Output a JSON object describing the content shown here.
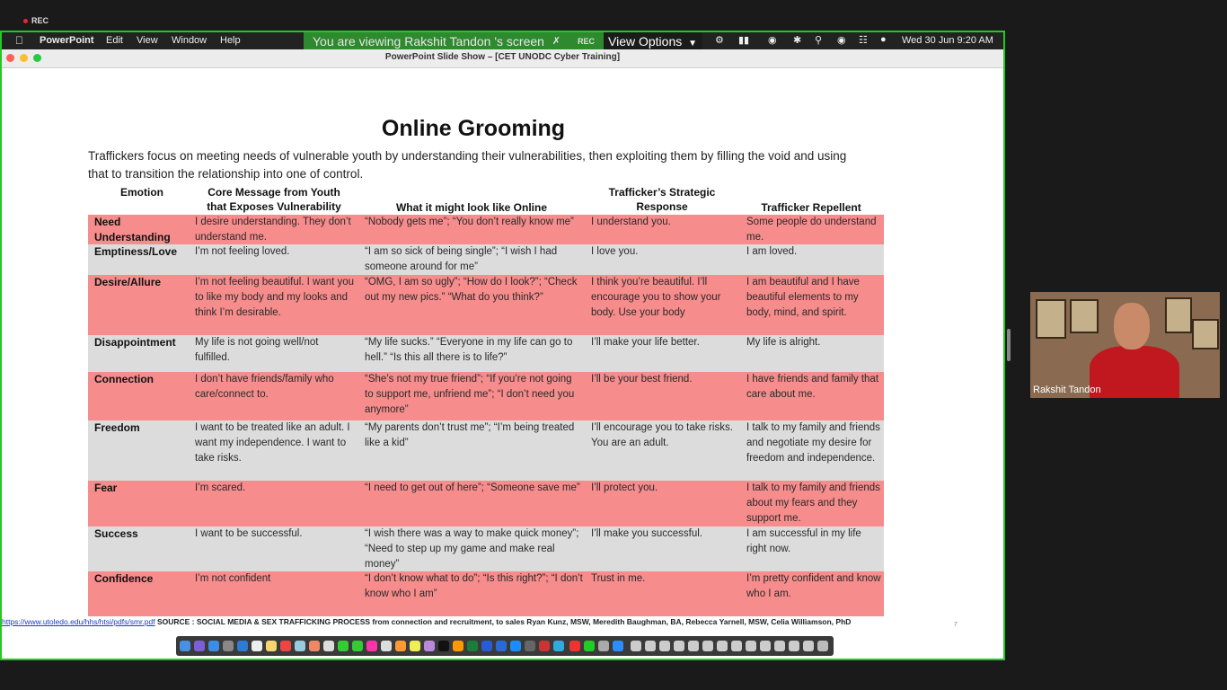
{
  "zoom": {
    "rec_label": "REC",
    "viewing_banner": "You are viewing Rakshit Tandon 's screen",
    "banner_rec": "REC",
    "view_options": "View Options",
    "participant_name": "Rakshit Tandon"
  },
  "mac_menubar": {
    "app_name": "PowerPoint",
    "menus": [
      "Edit",
      "View",
      "Window",
      "Help"
    ],
    "clock": "Wed 30 Jun  9:20 AM"
  },
  "window": {
    "title": "PowerPoint Slide Show – [CET UNODC Cyber Training]"
  },
  "slide": {
    "title": "Online Grooming",
    "intro": "Traffickers focus on meeting needs of vulnerable youth by understanding their vulnerabilities, then exploiting them by filling the void and using that to transition the relationship into one of control.",
    "headers": {
      "emotion": "Emotion",
      "core_message": "Core Message from Youth that Exposes Vulnerability",
      "online": "What it might look like Online",
      "strategic": "Trafficker’s Strategic Response",
      "repellent": "Trafficker Repellent"
    },
    "rows": [
      {
        "emotion": "Need Understanding",
        "core": "I desire understanding. They don’t understand me.",
        "online": "“Nobody gets me”; “You don’t really know me”",
        "response": "I understand you.",
        "repellent": "Some people do understand me."
      },
      {
        "emotion": "Emptiness/Love",
        "core": "I’m not feeling loved.",
        "online": "“I am so sick of being single”; “I wish I had someone around for me”",
        "response": "I love you.",
        "repellent": "I am loved."
      },
      {
        "emotion": "Desire/Allure",
        "core": "I’m not feeling beautiful. I want you to like my body and my looks and think I’m desirable.",
        "online": "“OMG, I am so ugly”; “How do I look?”; “Check out my new pics.” “What do you think?”",
        "response": "I think you’re beautiful. I’ll encourage you to show your body. Use your body",
        "repellent": "I am beautiful and I have beautiful elements to my body, mind, and spirit."
      },
      {
        "emotion": "Disappointment",
        "core": "My life is not going well/not fulfilled.",
        "online": "“My life sucks.” “Everyone in my life can go to hell.” “Is this all there is to life?”",
        "response": "I’ll make your life better.",
        "repellent": "My life is alright."
      },
      {
        "emotion": "Connection",
        "core": "I don’t have friends/family who care/connect to.",
        "online": "“She’s not my true friend”; “If you’re not going to support me, unfriend me”; “I don’t need you anymore”",
        "response": "I’ll be your best friend.",
        "repellent": "I have friends and family that care about me."
      },
      {
        "emotion": "Freedom",
        "core": "I want to be treated like an adult. I want my independence. I want to take risks.",
        "online": "“My parents don’t trust me”; “I’m being treated like a kid”",
        "response": "I’ll encourage you to take risks. You are an adult.",
        "repellent": "I talk to my family and friends and negotiate my desire for freedom and independence."
      },
      {
        "emotion": "Fear",
        "core": "I’m scared.",
        "online": "“I need to get out of here”; “Someone save me”",
        "response": "I’ll protect you.",
        "repellent": "I talk to my family and friends about my fears and they support me."
      },
      {
        "emotion": "Success",
        "core": "I want to be successful.",
        "online": "“I wish there was a way to make quick money”; “Need to step up my game and make real money”",
        "response": "I’ll make you successful.",
        "repellent": "I am successful in my life right now."
      },
      {
        "emotion": "Confidence",
        "core": "I’m not confident",
        "online": "“I don’t know what to do”; “Is this right?”; “I don’t know who I am”",
        "response": "Trust in me.",
        "repellent": "I’m pretty confident and know who I am."
      }
    ],
    "footer_link": "https://www.utoledo.edu/hhs/htsi/pdfs/smr.pdf",
    "footer_source": "SOURCE : SOCIAL MEDIA & SEX TRAFFICKING PROCESS from connection and recruitment, to sales Ryan Kunz, MSW, Meredith Baughman, BA, Rebecca Yarnell, MSW, Celia Williamson, PhD",
    "page_number": "7"
  },
  "colors": {
    "red_row": "#f68c8c",
    "gray_row": "#dcdcdc",
    "share_border": "#22c922"
  }
}
